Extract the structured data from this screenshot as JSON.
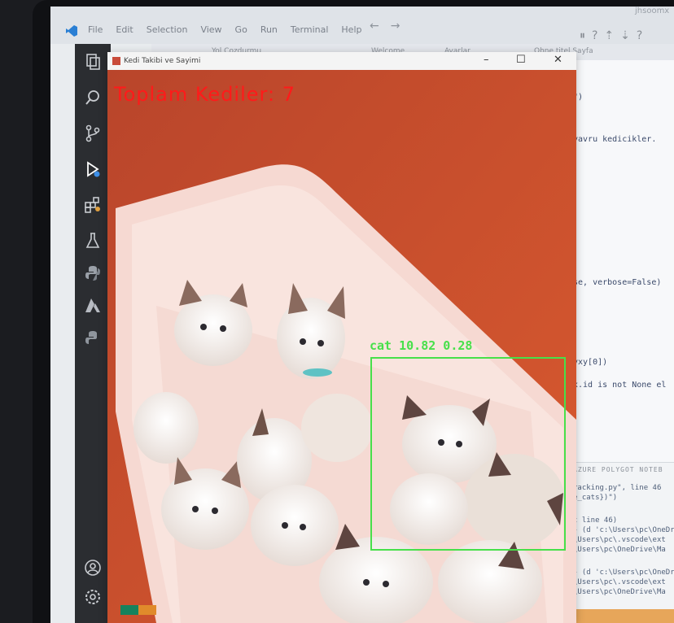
{
  "vscode": {
    "menu": [
      "File",
      "Edit",
      "Selection",
      "View",
      "Go",
      "Run",
      "Terminal",
      "Help"
    ],
    "search_text": "jhsoomx",
    "tab_labels": [
      "Yol Cozdurmu",
      "Welcome",
      "Ayarlar",
      "Ohne titel Sayfa"
    ],
    "colors": {
      "activity_bar": "#2b2d31",
      "status_green": "#16825d",
      "status_orange": "#e08a2b"
    }
  },
  "activity_icons": [
    "explorer-icon",
    "search-icon",
    "source-control-icon",
    "run-debug-icon",
    "extensions-icon",
    "testing-icon",
    "python-icon",
    "azure-icon",
    "docker-icon",
    "account-icon",
    "settings-icon"
  ],
  "editor": {
    "code_lines": [
      "\")",
      "yavru kedicikler.",
      "se, verbose=False)",
      "yxy[0])",
      "x.id is not None el"
    ],
    "panel_tabs": "AZURE    POLYGOT NOTEB",
    "terminal_lines": [
      "racking.py\", line 46",
      "e_cats})\")",
      "",
      "t line 46)",
      "} (d 'c:\\Users\\pc\\OneDr",
      "\\Users\\pc\\.vscode\\ext",
      "\\Users\\pc\\OneDrive\\Ma",
      "",
      "} (d 'c:\\Users\\pc\\OneDr",
      "\\Users\\pc\\.vscode\\ext",
      "\\Users\\pc\\OneDrive\\Ma"
    ]
  },
  "cv_window": {
    "title": "Kedi Takibi ve Sayimi",
    "overlay_text": "Toplam Kediler: 7",
    "detection_label": "cat 10.82 0.28",
    "colors": {
      "overlay_red": "#ff1a1a",
      "box_green": "#47e04a"
    }
  }
}
